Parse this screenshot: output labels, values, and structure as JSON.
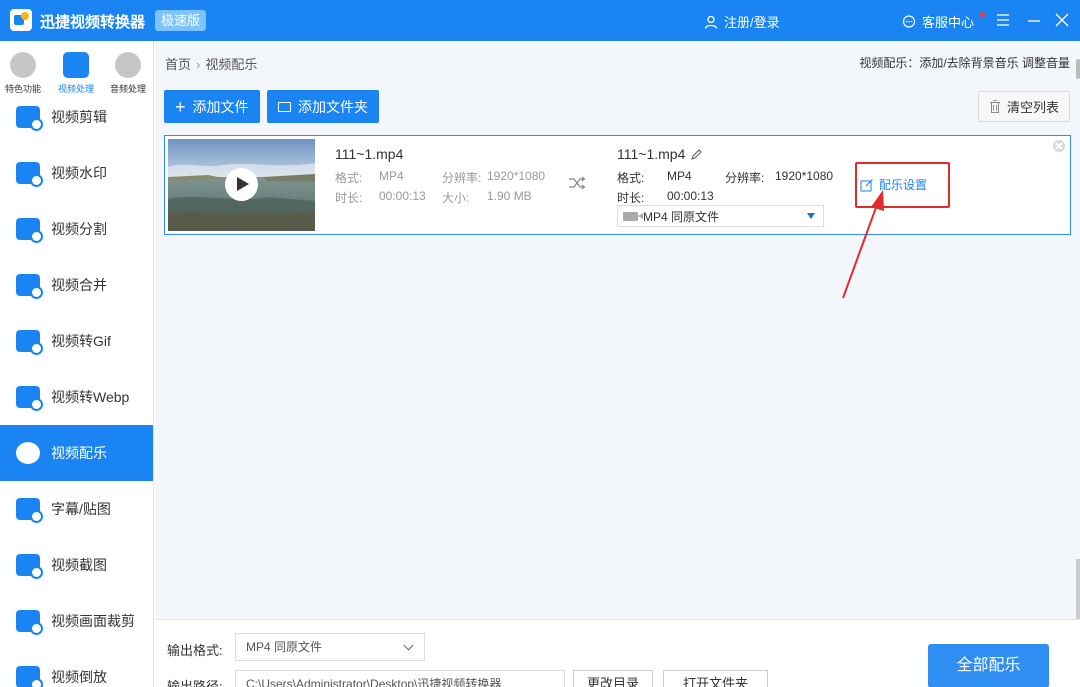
{
  "titlebar": {
    "app_title": "迅捷视频转换器",
    "edition": "极速版",
    "login": "注册/登录",
    "service": "客服中心",
    "menu_icon": "hamburger-icon",
    "minimize_icon": "minimize-icon",
    "close_icon": "close-icon"
  },
  "sidebar": {
    "categories": [
      {
        "label": "特色功能",
        "icon": "star-icon"
      },
      {
        "label": "视频处理",
        "icon": "film-icon"
      },
      {
        "label": "音频处理",
        "icon": "music-note-icon"
      }
    ],
    "items": [
      {
        "label": "视频剪辑"
      },
      {
        "label": "视频水印"
      },
      {
        "label": "视频分割"
      },
      {
        "label": "视频合并"
      },
      {
        "label": "视频转Gif"
      },
      {
        "label": "视频转Webp"
      },
      {
        "label": "视频配乐"
      },
      {
        "label": "字幕/贴图"
      },
      {
        "label": "视频截图"
      },
      {
        "label": "视频画面裁剪"
      },
      {
        "label": "视频倒放"
      }
    ]
  },
  "main": {
    "breadcrumb": {
      "home": "首页",
      "current": "视频配乐"
    },
    "hint": "视频配乐：添加/去除背景音乐 调整音量",
    "toolbar": {
      "add_file": "添加文件",
      "add_folder": "添加文件夹",
      "clear_list": "清空列表"
    },
    "file": {
      "source": {
        "name": "111~1.mp4",
        "format_label": "格式:",
        "format": "MP4",
        "resolution_label": "分辨率:",
        "resolution": "1920*1080",
        "duration_label": "时长:",
        "duration": "00:00:13",
        "size_label": "大小:",
        "size": "1.90 MB"
      },
      "output": {
        "name": "111~1.mp4",
        "format_label": "格式:",
        "format": "MP4",
        "resolution_label": "分辨率:",
        "resolution": "1920*1080",
        "duration_label": "时长:",
        "duration": "00:00:13",
        "format_select": "MP4  同原文件"
      },
      "music_setting": "配乐设置"
    },
    "bottom": {
      "output_format_label": "输出格式:",
      "output_format_value": "MP4  同原文件",
      "output_path_label": "输出路径:",
      "output_path_value": "C:\\Users\\Administrator\\Desktop\\迅捷视频转换器",
      "change_dir": "更改目录",
      "open_folder": "打开文件夹",
      "start_all": "全部配乐"
    }
  },
  "colors": {
    "brand": "#1a84f3",
    "highlight": "#e42a2a"
  }
}
